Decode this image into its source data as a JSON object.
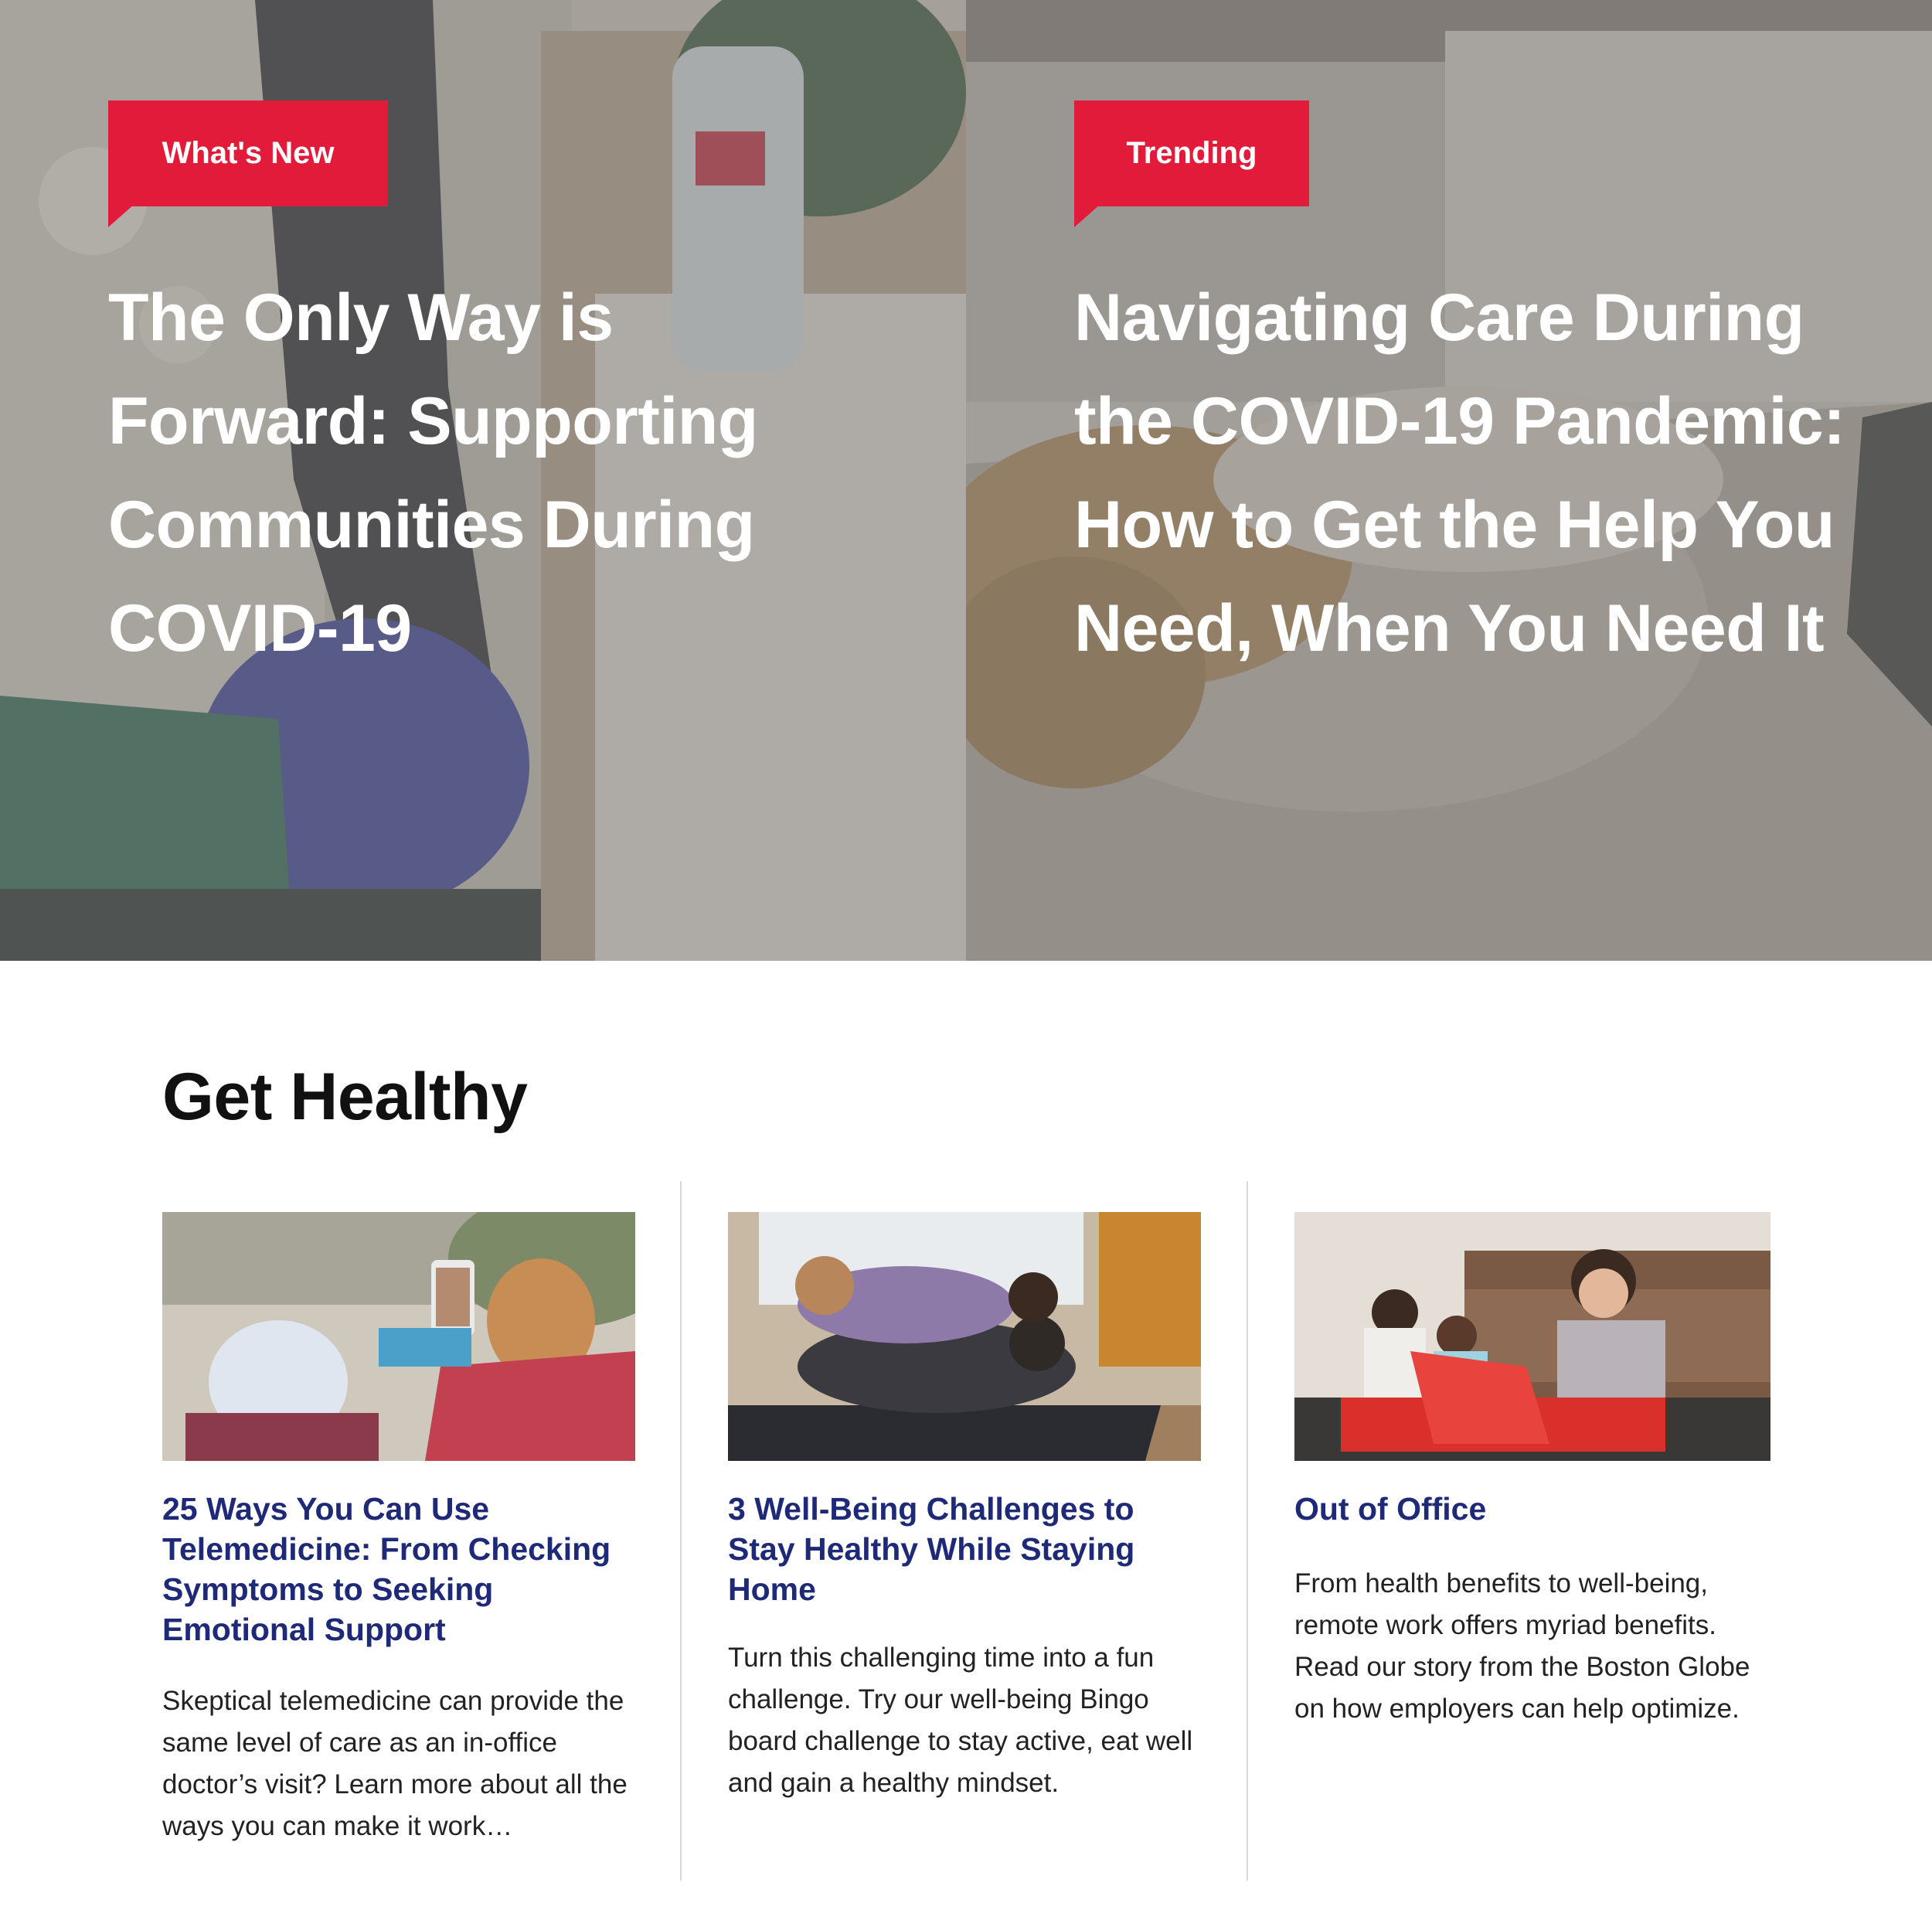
{
  "hero": {
    "left": {
      "badge": "What's New",
      "title": "The Only Way is Forward: Supporting Communities During COVID-19"
    },
    "right": {
      "badge": "Trending",
      "title": "Navigating Care During the COVID-19 Pandemic: How to Get the Help You Need, When You Need It"
    }
  },
  "section": {
    "title": "Get Healthy"
  },
  "cards": [
    {
      "title": "25 Ways You Can Use Telemedicine: From Checking Symptoms to Seeking Emotional Support",
      "description": "Skeptical telemedicine can provide the same level of care as an in-office doctor’s visit? Learn more about all the ways you can make it work…"
    },
    {
      "title": "3 Well-Being Challenges to Stay Healthy While Staying Home",
      "description": "Turn this challenging time into a fun challenge. Try our well-being Bingo board challenge to stay active, eat well and gain a healthy mindset."
    },
    {
      "title": "Out of Office",
      "description": "From health benefits to well-being, remote work offers myriad benefits. Read our story from the Boston Globe on how employers can help optimize."
    }
  ],
  "colors": {
    "accent_red": "#e31b3a",
    "link_navy": "#1e2a78",
    "overlay_gray": "#767676"
  }
}
